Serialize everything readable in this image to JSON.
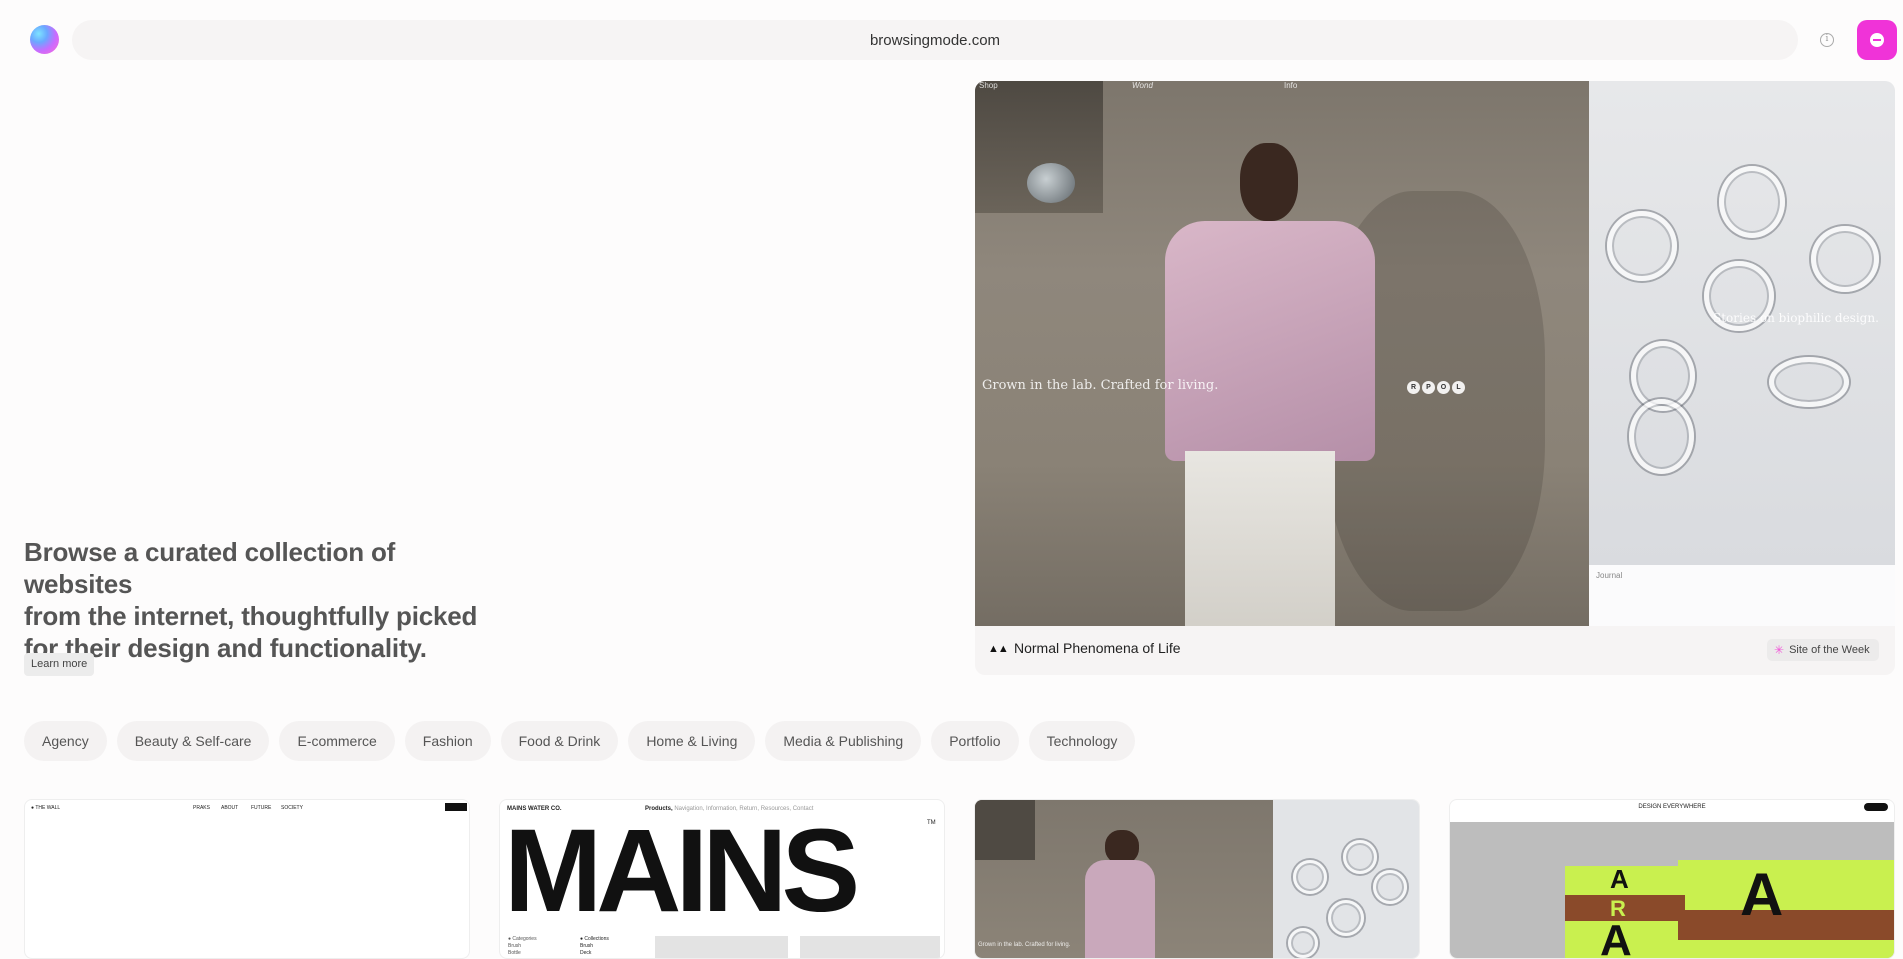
{
  "topbar": {
    "url": "browsingmode.com",
    "info_icon": "info-icon",
    "info_glyph": "i",
    "submit_icon": "plus-circle-icon"
  },
  "hero": {
    "line1": "Browse a curated collection of websites",
    "line2": "from the internet, thoughtfully picked",
    "line3": "for their design and functionality.",
    "learn_more": "Learn more"
  },
  "featured": {
    "nav_shop": "Shop",
    "nav_wond": "Wond",
    "nav_info": "Info",
    "caption_left": "Grown in the lab. Crafted for living.",
    "rpol": [
      "R",
      "P",
      "O",
      "L"
    ],
    "caption_right": "Stories on biophilic design.",
    "right_foot": "Journal",
    "title": "Normal Phenomena of Life",
    "title_icon": "▲▲",
    "badge": "Site of the Week",
    "badge_icon": "✳"
  },
  "categories": [
    "Agency",
    "Beauty & Self-care",
    "E-commerce",
    "Fashion",
    "Food & Drink",
    "Home & Living",
    "Media & Publishing",
    "Portfolio",
    "Technology"
  ],
  "gallery": {
    "t1": {
      "brand": "● THE WALL",
      "nav": [
        "PRAKS",
        "ABOUT",
        "FUTURE",
        "SOCIETY"
      ]
    },
    "t2": {
      "brand": "MAINS WATER CO.",
      "products": "Products,",
      "products_rest": " Navigation, Information, Return, Resources, Contact",
      "word": "MAINS",
      "tm": "TM",
      "list1": [
        "● Categories",
        "Brush",
        "Bottle"
      ],
      "list2": [
        "● Collections",
        "Brush",
        "Deck"
      ]
    },
    "t3": {
      "caption": "Grown in the lab. Crafted for living."
    },
    "t4": {
      "title": "DESIGN EVERYWHERE",
      "letters": [
        "A",
        "R",
        "A",
        "A"
      ]
    }
  },
  "colors": {
    "accent": "#f033d8",
    "chip_bg": "#f4f2f2"
  }
}
